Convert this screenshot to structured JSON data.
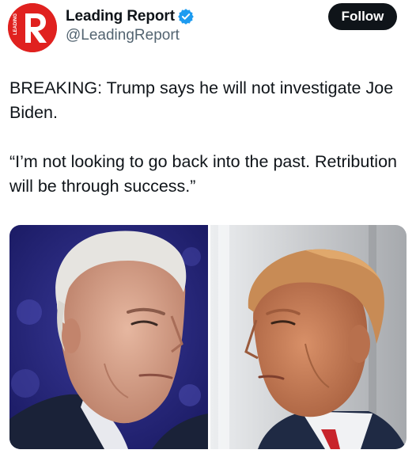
{
  "account": {
    "display_name": "Leading Report",
    "handle": "@LeadingReport",
    "verified": true,
    "avatar_icon": "leading-report-logo",
    "avatar_color": "#e0211f",
    "verified_color": "#1d9bf0"
  },
  "follow_button": {
    "label": "Follow"
  },
  "tweet": {
    "paragraphs": [
      "BREAKING: Trump says he will not investigate Joe Biden.",
      "“I’m not looking to go back into the past. Retribution will be through success.”"
    ]
  },
  "media": {
    "photos": [
      {
        "subject": "biden-portrait",
        "background": "#2a2a7a"
      },
      {
        "subject": "trump-portrait",
        "background": "#d8d9db"
      }
    ]
  }
}
